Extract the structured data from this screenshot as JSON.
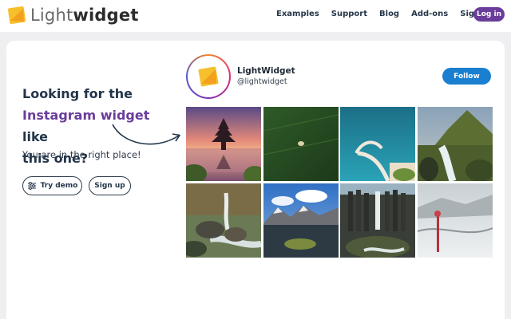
{
  "brand": {
    "light": "Light",
    "widget": "widget"
  },
  "nav": [
    {
      "label": "Examples"
    },
    {
      "label": "Support"
    },
    {
      "label": "Blog"
    },
    {
      "label": "Add-ons"
    },
    {
      "label": "Sign up"
    }
  ],
  "login_label": "Log in",
  "hero": {
    "line1": "Looking for the",
    "accent": "Instagram widget",
    "line2_rest": " like",
    "line3": "this one?",
    "subtext": "You are in the right place!",
    "try_demo": "Try demo",
    "sign_up": "Sign up"
  },
  "profile": {
    "name": "LightWidget",
    "handle": "@lightwidget",
    "follow_label": "Follow"
  },
  "colors": {
    "accent_purple": "#6a3d9a",
    "follow_blue": "#1a7fd0",
    "logo_yellow": "#f6c02c"
  },
  "photos": [
    {
      "subject": "temple-sunset"
    },
    {
      "subject": "green-field-aerial"
    },
    {
      "subject": "ocean-pier-aerial"
    },
    {
      "subject": "mountain-waterfall"
    },
    {
      "subject": "waterfall-rocks"
    },
    {
      "subject": "mountain-beach"
    },
    {
      "subject": "basalt-waterfall"
    },
    {
      "subject": "glacier-ice"
    }
  ]
}
